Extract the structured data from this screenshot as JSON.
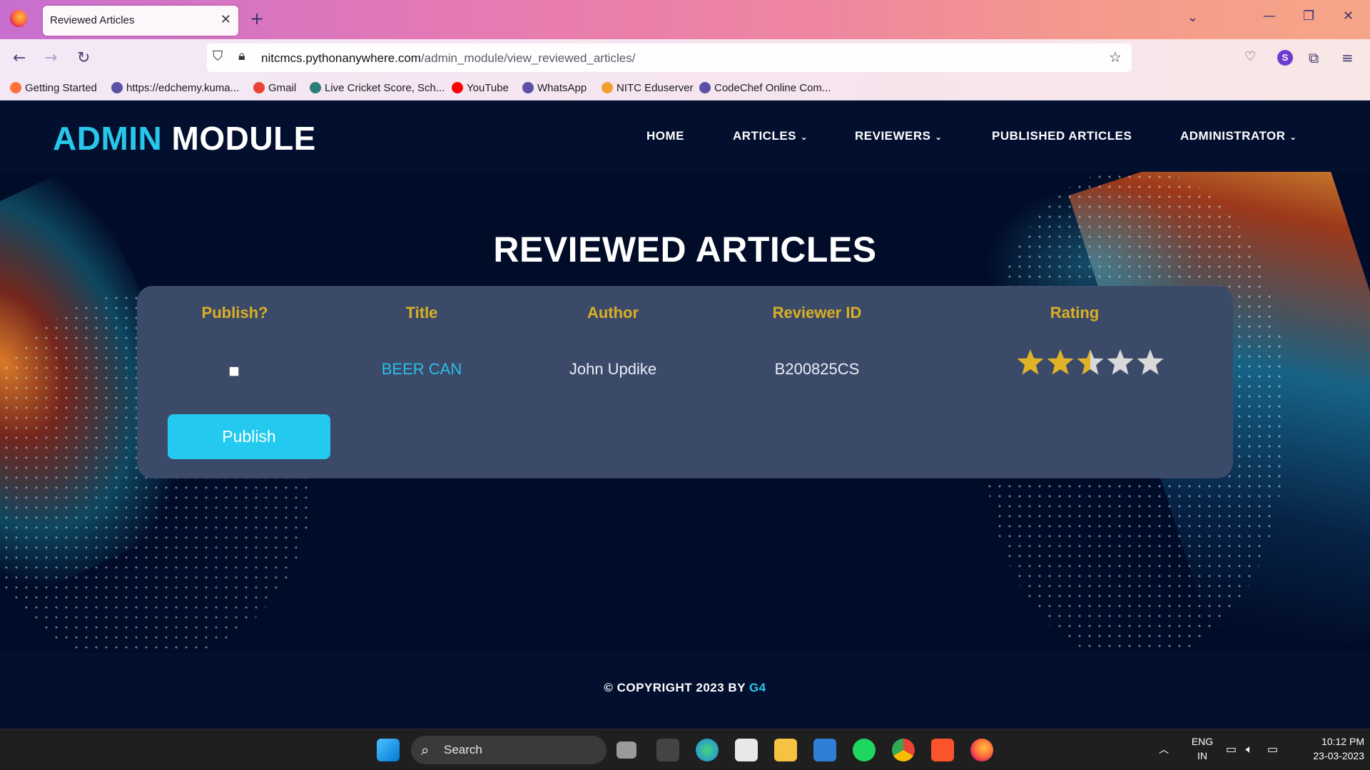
{
  "browser": {
    "tab_title": "Reviewed Articles",
    "tab_close": "✕",
    "new_tab": "+",
    "url_host": "nitcmcs.pythonanywhere.com",
    "url_path": "/admin_module/view_reviewed_articles/",
    "bookmarks": [
      {
        "label": "Getting Started",
        "color": "#ff7139"
      },
      {
        "label": "https://edchemy.kuma...",
        "color": "#5b4fa8"
      },
      {
        "label": "Gmail",
        "color": "#ea4335"
      },
      {
        "label": "Live Cricket Score, Sch...",
        "color": "#2e7d7a"
      },
      {
        "label": "YouTube",
        "color": "#ff0000"
      },
      {
        "label": "WhatsApp",
        "color": "#5b4fa8"
      },
      {
        "label": "NITC Eduserver",
        "color": "#f0a030"
      },
      {
        "label": "CodeChef Online Com...",
        "color": "#5b4fa8"
      }
    ]
  },
  "site": {
    "logo_accent": "ADMIN",
    "logo_rest": "MODULE",
    "nav": [
      {
        "label": "HOME",
        "dropdown": false
      },
      {
        "label": "ARTICLES",
        "dropdown": true
      },
      {
        "label": "REVIEWERS",
        "dropdown": true
      },
      {
        "label": "PUBLISHED ARTICLES",
        "dropdown": false
      },
      {
        "label": "ADMINISTRATOR",
        "dropdown": true
      }
    ],
    "chevron": "⌄",
    "page_title": "REVIEWED ARTICLES",
    "table": {
      "headers": [
        "Publish?",
        "Title",
        "Author",
        "Reviewer ID",
        "Rating"
      ],
      "rows": [
        {
          "publish_checked": false,
          "title": "BEER CAN",
          "author": "John Updike",
          "reviewer_id": "B200825CS",
          "rating": 2.5,
          "rating_max": 5
        }
      ]
    },
    "publish_button": "Publish",
    "footer": {
      "text": "© COPYRIGHT 2023 BY ",
      "link": "G4"
    }
  },
  "colors": {
    "accent": "#28c7ea",
    "header_gold": "#d9b021",
    "card_bg": "#3c4a6a",
    "star_on": "#e0b227",
    "star_off": "#d9d9d9"
  },
  "taskbar": {
    "search_label": "Search",
    "lang_1": "ENG",
    "lang_2": "IN",
    "time": "10:12 PM",
    "date": "23-03-2023"
  }
}
